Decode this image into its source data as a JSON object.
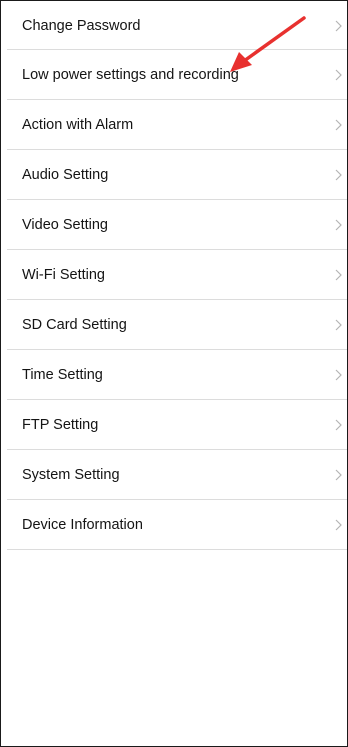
{
  "settings": {
    "items": [
      {
        "label": "Change Password",
        "icon": "chevron-right-icon"
      },
      {
        "label": "Low power settings and recording",
        "icon": "chevron-right-icon"
      },
      {
        "label": "Action with Alarm",
        "icon": "chevron-right-icon"
      },
      {
        "label": "Audio Setting",
        "icon": "chevron-right-icon"
      },
      {
        "label": "Video Setting",
        "icon": "chevron-right-icon"
      },
      {
        "label": "Wi-Fi Setting",
        "icon": "chevron-right-icon"
      },
      {
        "label": "SD Card Setting",
        "icon": "chevron-right-icon"
      },
      {
        "label": "Time Setting",
        "icon": "chevron-right-icon"
      },
      {
        "label": "FTP Setting",
        "icon": "chevron-right-icon"
      },
      {
        "label": "System Setting",
        "icon": "chevron-right-icon"
      },
      {
        "label": "Device Information",
        "icon": "chevron-right-icon"
      }
    ]
  },
  "annotation": {
    "arrow_color": "#e8312f",
    "points_to": "Low power settings and recording"
  },
  "colors": {
    "text": "#141414",
    "divider": "#dcdcdc",
    "chevron": "#b5b5b5",
    "background": "#ffffff"
  }
}
